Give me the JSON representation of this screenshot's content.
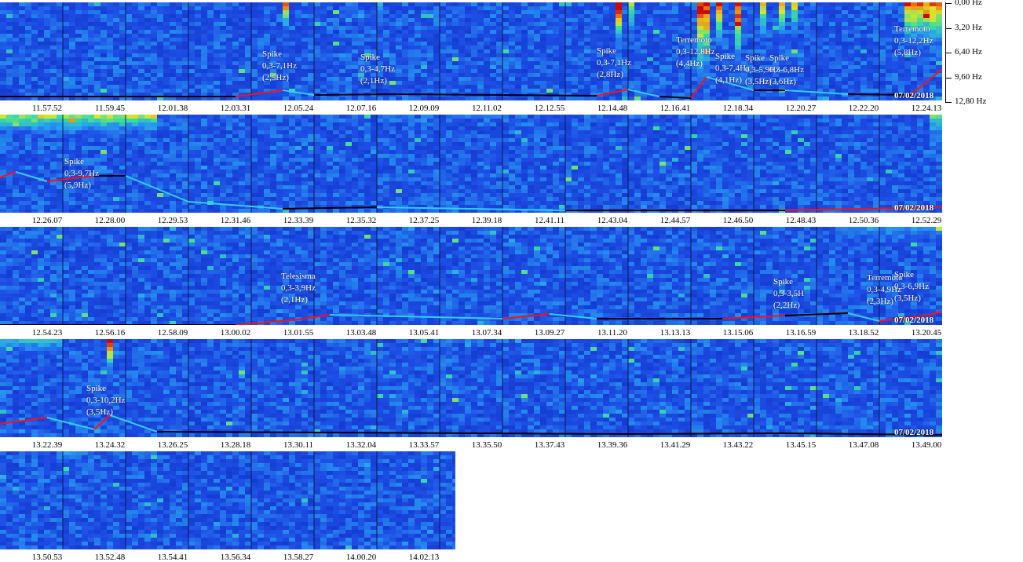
{
  "freq_axis": [
    "0,00 Hz",
    "3,20 Hz",
    "6,40 Hz",
    "9,60 Hz",
    "12,80 Hz"
  ],
  "chart_data": [
    {
      "type": "heatmap",
      "date": "07/02/2018",
      "x_ticks": [
        "11.57.52",
        "11.59.45",
        "12.01.38",
        "12.03.31",
        "12.05.24",
        "12.07.16",
        "12.09.09",
        "12.11.02",
        "12.12.55",
        "12.14.48",
        "12.16.41",
        "12.18.34",
        "12.20.27",
        "12.22.20",
        "12.24.13"
      ],
      "y_ticks": [
        "0,00 Hz",
        "3,20 Hz",
        "6,40 Hz",
        "9,60 Hz",
        "12,80 Hz"
      ],
      "ylim": [
        0,
        12.8
      ],
      "annotations": [
        {
          "lines": [
            "Spike",
            "0,3-7,1Hz",
            "(2,5Hz)"
          ]
        },
        {
          "lines": [
            "Spike",
            "0,3-4,7Hz",
            "(2,1Hz)"
          ]
        },
        {
          "lines": [
            "Spike",
            "0,3-7,1Hz",
            "(2,8Hz)"
          ]
        },
        {
          "lines": [
            "Terremoto",
            "0,3-12,8Hz",
            "(4,4Hz)"
          ]
        },
        {
          "lines": [
            "Spike",
            "0,3-7,4Hz",
            "(4,1Hz)"
          ]
        },
        {
          "lines": [
            "Spike",
            "0,3-5,9Hz",
            "(3,5Hz)"
          ]
        },
        {
          "lines": [
            "Spike",
            "0,3-6,8Hz",
            "(3,6Hz)"
          ]
        },
        {
          "lines": [
            "Terremoto",
            "0,3-12,2Hz",
            "(5,8Hz)"
          ]
        }
      ]
    },
    {
      "type": "heatmap",
      "date": "07/02/2018",
      "x_ticks": [
        "12.26.07",
        "12.28.00",
        "12.29.53",
        "12.31.46",
        "12.33.39",
        "12.35.32",
        "12.37.25",
        "12.39.18",
        "12.41.11",
        "12.43.04",
        "12.44.57",
        "12.46.50",
        "12.48.43",
        "12.50.36",
        "12.52.29"
      ],
      "annotations": [
        {
          "lines": [
            "Spike",
            "0,3-9,7Hz",
            "(5,9Hz)"
          ]
        }
      ]
    },
    {
      "type": "heatmap",
      "date": "07/02/2018",
      "x_ticks": [
        "12.54.23",
        "12.56.16",
        "12.58.09",
        "13.00.02",
        "13.01.55",
        "13.03.48",
        "13.05.41",
        "13.07.34",
        "13.09.27",
        "13.11.20",
        "13.13.13",
        "13.15.06",
        "13.16.59",
        "13.18.52",
        "13.20.45"
      ],
      "annotations": [
        {
          "lines": [
            "Telesisma",
            "0,3-3,9Hz",
            "(2,1Hz)"
          ]
        },
        {
          "lines": [
            "Spike",
            "0,3-3,5H",
            "(2,2Hz)"
          ]
        },
        {
          "lines": [
            "Terremoto",
            "0,3-4,9Hz",
            "(2,3Hz)"
          ]
        },
        {
          "lines": [
            "Spike",
            "0,3-6,9Hz",
            "(3,5Hz)"
          ]
        }
      ]
    },
    {
      "type": "heatmap",
      "date": "07/02/2018",
      "x_ticks": [
        "13.22.39",
        "13.24.32",
        "13.26.25",
        "13.28.18",
        "13.30.11",
        "13.32.04",
        "13.33.57",
        "13.35.50",
        "13.37.43",
        "13.39.36",
        "13.41.29",
        "13.43.22",
        "13.45.15",
        "13.47.08",
        "13.49.00"
      ],
      "annotations": [
        {
          "lines": [
            "Spike",
            "0,3-10,2Hz",
            "(3,5Hz)"
          ]
        }
      ]
    },
    {
      "type": "heatmap",
      "x_ticks": [
        "13.50.53",
        "13.52.48",
        "13.54.41",
        "13.56.34",
        "13.58.27",
        "14.00.20",
        "14.02.13"
      ],
      "annotations": []
    }
  ]
}
